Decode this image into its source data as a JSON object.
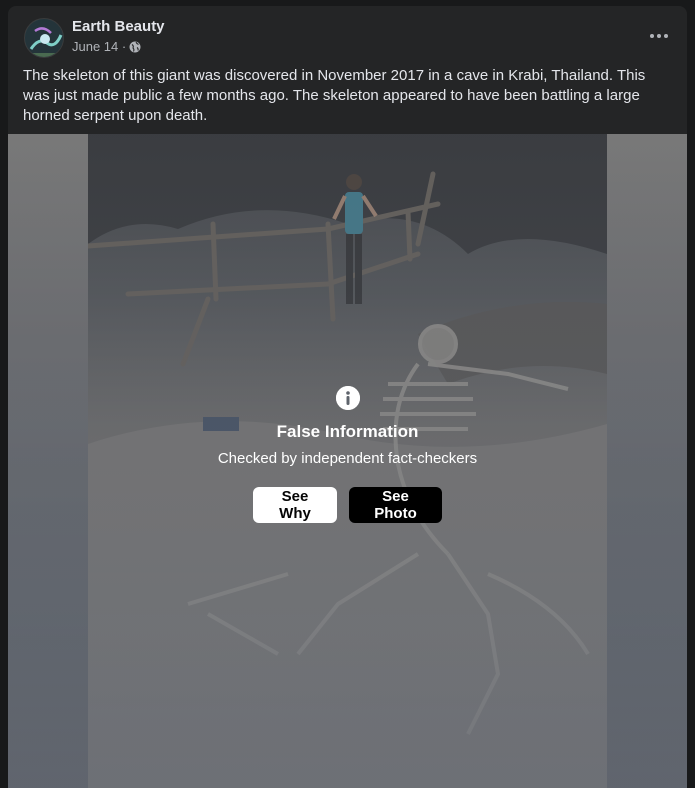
{
  "post": {
    "author": "Earth Beauty",
    "date": "June 14 ·",
    "caption": "The skeleton of this giant was discovered in November 2017 in a cave in Krabi, Thailand. This was just made public a few months ago. The skeleton appeared to have been battling a large horned serpent upon death."
  },
  "icons": {
    "privacy": "globe-icon",
    "more": "more-options-icon",
    "info": "info-icon"
  },
  "overlay": {
    "title": "False Information",
    "subtitle": "Checked by independent fact-checkers",
    "see_why_label": "See Why",
    "see_photo_label": "See Photo"
  },
  "colors": {
    "card_background": "#242526",
    "see_why_bg": "#ffffff",
    "see_photo_bg": "#000000"
  }
}
